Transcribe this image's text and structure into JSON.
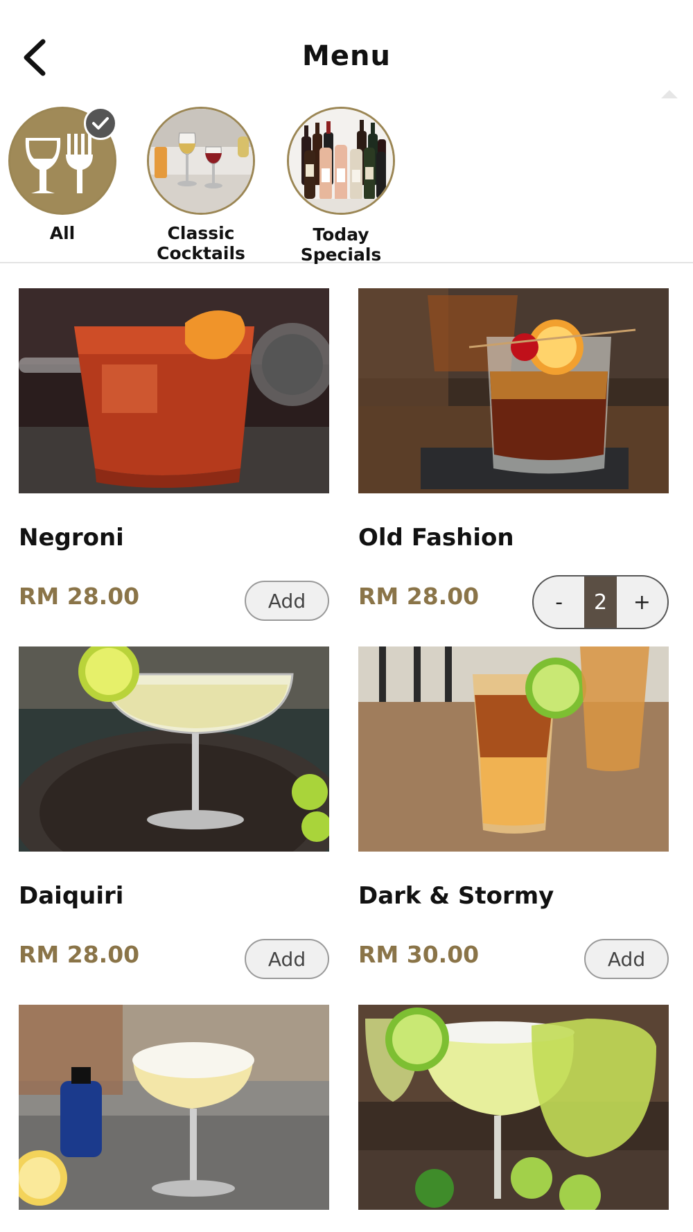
{
  "header": {
    "title": "Menu"
  },
  "categories": [
    {
      "label": "All",
      "icon": "wine-glass-fork-icon",
      "selected": true
    },
    {
      "label_line1": "Classic",
      "label_line2": "Cocktails",
      "icon": "cocktail-glasses-photo"
    },
    {
      "label": "Today Specials",
      "icon": "wine-bottles-photo"
    }
  ],
  "items": [
    {
      "name": "Negroni",
      "price": "RM 28.00",
      "action": "Add",
      "photo": "negroni-photo"
    },
    {
      "name": "Old Fashion",
      "price": "RM 28.00",
      "quantity": "2",
      "minus": "-",
      "plus": "+",
      "photo": "old-fashion-photo"
    },
    {
      "name": "Daiquiri",
      "price": "RM 28.00",
      "action": "Add",
      "photo": "daiquiri-photo"
    },
    {
      "name": "Dark & Stormy",
      "price": "RM 30.00",
      "action": "Add",
      "photo": "dark-and-stormy-photo"
    },
    {
      "photo": "whiskey-sour-photo"
    },
    {
      "photo": "margarita-photo"
    }
  ],
  "colors": {
    "accent": "#8a7448",
    "ring": "#9b8654",
    "stepper_qty_bg": "#5b4f44"
  }
}
